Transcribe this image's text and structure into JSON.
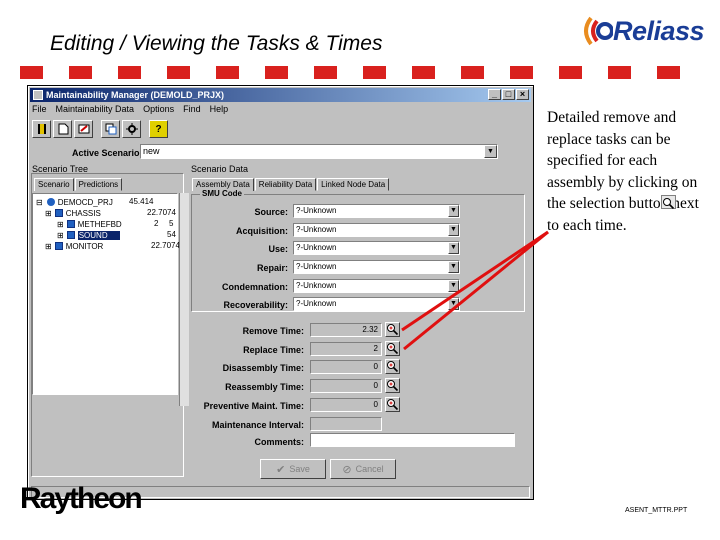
{
  "slide": {
    "title": "Editing / Viewing the Tasks & Times",
    "logo_text": "Reliass",
    "description": "Detailed remove and replace tasks can be specified for each assembly by clicking on the selection button next to each time.",
    "footer_brand": "Raytheon",
    "footer_tag": "ASENT_MTTR.PPT",
    "accent_red": "#d9211e",
    "logo_blue": "#1a3d96"
  },
  "window": {
    "title": "Maintainability Manager (DEMOLD_PRJX)",
    "controls": [
      "_",
      "□",
      "×"
    ],
    "menu": [
      "File",
      "Maintainability Data",
      "Options",
      "Find",
      "Help"
    ],
    "toolbar_icons": [
      "book-icon",
      "new-doc-icon",
      "edit-icon",
      "copy-icon",
      "settings-icon",
      "help-icon"
    ],
    "active_scenario_label": "Active Scenario:",
    "active_scenario_value": "new"
  },
  "scenario_tree": {
    "label": "Scenario Tree",
    "tabs": [
      "Scenario",
      "Predictions"
    ],
    "rows": [
      {
        "name": "DEMOCD_PRJ",
        "c1": "45.414",
        "c2": "",
        "indent": 0,
        "selected": false
      },
      {
        "name": "CHASSIS",
        "c1": "22.7074",
        "c2": "",
        "indent": 1,
        "selected": false
      },
      {
        "name": "METHEFBD",
        "c1": "2",
        "c2": "5",
        "indent": 2,
        "selected": false
      },
      {
        "name": "SOUND",
        "c1": "",
        "c2": "54",
        "indent": 2,
        "selected": true
      },
      {
        "name": "MONITOR",
        "c1": "22.7074",
        "c2": "",
        "indent": 1,
        "selected": false
      }
    ]
  },
  "scenario_data": {
    "label": "Scenario Data",
    "tabs": [
      "Assembly Data",
      "Reliability Data",
      "Linked Node Data"
    ],
    "group_title": "SMU Code",
    "fields": [
      {
        "label": "Source:",
        "value": "?-Unknown"
      },
      {
        "label": "Acquisition:",
        "value": "?-Unknown"
      },
      {
        "label": "Use:",
        "value": "?-Unknown"
      },
      {
        "label": "Repair:",
        "value": "?-Unknown"
      },
      {
        "label": "Condemnation:",
        "value": "?-Unknown"
      },
      {
        "label": "Recoverability:",
        "value": "?-Unknown"
      }
    ],
    "times": [
      {
        "label": "Remove Time:",
        "value": "2.32"
      },
      {
        "label": "Replace Time:",
        "value": "2"
      },
      {
        "label": "Disassembly Time:",
        "value": "0"
      },
      {
        "label": "Reassembly Time:",
        "value": "0"
      },
      {
        "label": "Preventive Maint. Time:",
        "value": "0"
      }
    ],
    "maintenance_interval_label": "Maintenance Interval:",
    "comments_label": "Comments:",
    "save_label": "Save",
    "cancel_label": "Cancel"
  }
}
